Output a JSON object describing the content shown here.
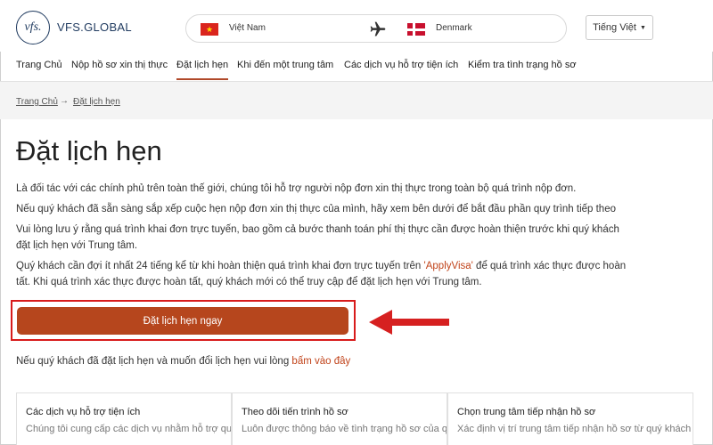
{
  "brand": {
    "logo_mark": "vfs.",
    "name": "VFS.GLOBAL"
  },
  "country_selector": {
    "from": "Việt Nam",
    "to": "Denmark",
    "icon": "airplane-icon"
  },
  "language": {
    "label": "Tiếng Việt"
  },
  "nav": {
    "items": [
      {
        "label": "Trang Chủ"
      },
      {
        "label": "Nộp hồ sơ xin thị thực"
      },
      {
        "label": "Đặt lịch hẹn",
        "active": true
      },
      {
        "label": "Khi đến một trung tâm"
      },
      {
        "label": "Các dịch vụ hỗ trợ tiện ích"
      },
      {
        "label": "Kiểm tra tình trạng hồ sơ"
      }
    ]
  },
  "breadcrumb": {
    "home": "Trang Chủ",
    "separator": "→",
    "current": "Đặt lịch hẹn"
  },
  "page": {
    "title": "Đặt lịch hẹn",
    "p1": "Là đối tác với các chính phủ trên toàn thế giới, chúng tôi hỗ trợ người nộp đơn xin thị thực trong toàn bộ quá trình nộp đơn.",
    "p2": "Nếu quý khách đã sẵn sàng sắp xếp cuộc hẹn nộp đơn xin thị thực của mình, hãy xem bên dưới để bắt đầu phần quy trình tiếp theo",
    "p3_line1": "Vui lòng lưu ý rằng quá trình khai đơn trực tuyến, bao gồm cả bước thanh toán phí thị thực cần được hoàn thiện trước khi quý khách",
    "p3_line2": "đặt lịch hẹn với Trung tâm.",
    "p4_before": "Quý khách cần đợi ít nhất 24 tiếng kể từ khi hoàn thiện quá trình khai đơn trực tuyến trên ",
    "p4_link": "'ApplyVisa'",
    "p4_after": " để quá trình xác thực được hoàn",
    "p4_line2": "tất. Khi quá trình xác thực được hoàn tất, quý khách mới có thể truy cập để đặt lịch hẹn với Trung tâm.",
    "cta_label": "Đặt lịch hẹn ngay",
    "reschedule_text": "Nếu quý khách đã đặt lịch hẹn và muốn đổi lịch hẹn vui lòng ",
    "reschedule_link": "bấm vào đây"
  },
  "cards": [
    {
      "title": "Các dịch vụ hỗ trợ tiện ích",
      "desc": "Chúng tôi cung cấp các dịch vụ nhằm hỗ trợ quý khách"
    },
    {
      "title": "Theo dõi tiến trình hồ sơ",
      "desc": "Luôn được thông báo về tình trạng hồ sơ của quý khách"
    },
    {
      "title": "Chọn trung tâm tiếp nhận hồ sơ",
      "desc": "Xác định vị trí trung tâm tiếp nhận hồ sơ từ quý khách"
    }
  ],
  "colors": {
    "accent": "#b6461d",
    "link": "#c1441b",
    "highlight_border": "#d81b1b",
    "arrow": "#d62020",
    "brand_navy": "#1f3a5f"
  }
}
